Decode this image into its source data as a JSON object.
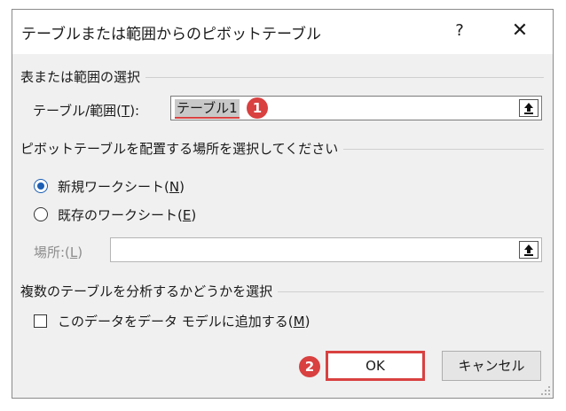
{
  "dialog": {
    "title": "テーブルまたは範囲からのピボットテーブル",
    "help_label": "?",
    "close_label": "✕"
  },
  "source_group": {
    "label": "表または範囲の選択",
    "table_range_label_pre": "テーブル/範囲(",
    "table_range_label_key": "T",
    "table_range_label_post": "):",
    "table_range_value": "テーブル1"
  },
  "placement_group": {
    "label": "ピボットテーブルを配置する場所を選択してください",
    "new_sheet_label_pre": "新規ワークシート(",
    "new_sheet_label_key": "N",
    "new_sheet_label_post": ")",
    "existing_sheet_label_pre": "既存のワークシート(",
    "existing_sheet_label_key": "E",
    "existing_sheet_label_post": ")",
    "location_label_pre": "場所:(",
    "location_label_key": "L",
    "location_label_post": ")",
    "location_value": "",
    "selected_option": "new_sheet"
  },
  "multi_table_group": {
    "label": "複数のテーブルを分析するかどうかを選択",
    "add_to_model_label_pre": "このデータをデータ モデルに追加する(",
    "add_to_model_label_key": "M",
    "add_to_model_label_post": ")",
    "add_to_model_checked": false
  },
  "buttons": {
    "ok_label": "OK",
    "cancel_label": "キャンセル"
  },
  "annotations": {
    "badge_1": "1",
    "badge_2": "2",
    "color": "#d94040"
  },
  "colors": {
    "accent": "#1a5fb4",
    "dialog_bg": "#f0f0f0"
  }
}
